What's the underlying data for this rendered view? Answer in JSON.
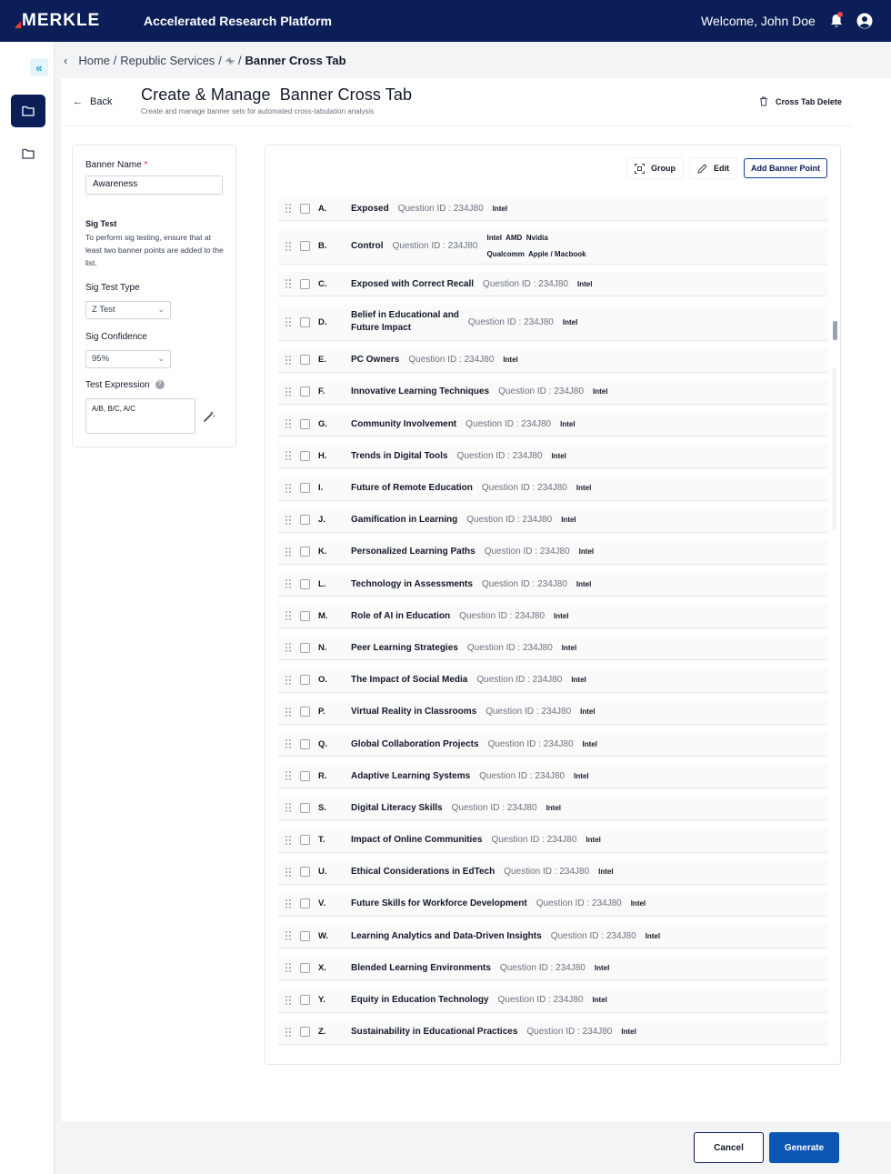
{
  "header": {
    "brand": "MERKLE",
    "app_title": "Accelerated Research Platform",
    "welcome": "Welcome, John Doe",
    "icons": [
      "notification-bell-icon",
      "user-profile-icon"
    ]
  },
  "breadcrumb": {
    "home": "Home /",
    "client": "Republic Services",
    "sep": "/ ",
    "current": "Banner Cross Tab"
  },
  "page": {
    "back": "Back",
    "title": "Create & Manage  Banner Cross Tab",
    "subtitle": "Create and manage banner sets for automated cross-tabulation analysis",
    "delete": "Cross Tab Delete"
  },
  "config": {
    "banner_name_label": "Banner Name",
    "required_mark": "*",
    "banner_name_value": "Awareness",
    "sig_test_title": "Sig Test",
    "sig_test_desc": "To perform sig testing, ensure that at least two banner points are added to the list.",
    "sig_test_type_label": "Sig Test Type",
    "sig_test_type_value": "Z Test",
    "sig_confidence_label": "Sig Confidence",
    "sig_confidence_value": "95%",
    "test_expression_label": "Test Expression",
    "help": "?",
    "test_expression_value": "A/B, B/C, A/C"
  },
  "toolbar": {
    "group": "Group",
    "edit": "Edit",
    "add": "Add Banner Point"
  },
  "rows": [
    {
      "letter": "A.",
      "title": "Exposed",
      "qid": "Question ID : 234J80",
      "tags": "Intel"
    },
    {
      "letter": "B.",
      "title": "Control",
      "qid": "Question ID : 234J80",
      "tags_line1": "Intel  AMD  Nvidia",
      "tags_line2": "Qualcomm  Apple / Macbook"
    },
    {
      "letter": "C.",
      "title": "Exposed with Correct Recall",
      "qid": "Question ID : 234J80",
      "tags": "Intel"
    },
    {
      "letter": "D.",
      "title_line1": "Belief in Educational and",
      "title_line2": "Future Impact",
      "qid": "Question ID : 234J80",
      "tags": "Intel"
    },
    {
      "letter": "E.",
      "title": "PC Owners",
      "qid": "Question ID : 234J80",
      "tags": "Intel"
    },
    {
      "letter": "F.",
      "title": "Innovative Learning Techniques",
      "qid": "Question ID : 234J80",
      "tags": "Intel"
    },
    {
      "letter": "G.",
      "title": "Community Involvement",
      "qid": "Question ID : 234J80",
      "tags": "Intel"
    },
    {
      "letter": "H.",
      "title": "Trends in Digital Tools",
      "qid": "Question ID : 234J80",
      "tags": "Intel"
    },
    {
      "letter": "I.",
      "title": "Future of Remote Education",
      "qid": "Question ID : 234J80",
      "tags": "Intel"
    },
    {
      "letter": "J.",
      "title": "Gamification in Learning",
      "qid": "Question ID : 234J80",
      "tags": "Intel"
    },
    {
      "letter": "K.",
      "title": "Personalized Learning Paths",
      "qid": "Question ID : 234J80",
      "tags": "Intel"
    },
    {
      "letter": "L.",
      "title": "Technology in Assessments",
      "qid": "Question ID : 234J80",
      "tags": "Intel"
    },
    {
      "letter": "M.",
      "title": "Role of AI in Education",
      "qid": "Question ID : 234J80",
      "tags": "Intel"
    },
    {
      "letter": "N.",
      "title": "Peer Learning Strategies",
      "qid": "Question ID : 234J80",
      "tags": "Intel"
    },
    {
      "letter": "O.",
      "title": "The Impact of Social Media",
      "qid": "Question ID : 234J80",
      "tags": "Intel"
    },
    {
      "letter": "P.",
      "title": "Virtual Reality in Classrooms",
      "qid": "Question ID : 234J80",
      "tags": "Intel"
    },
    {
      "letter": "Q.",
      "title": "Global Collaboration Projects",
      "qid": "Question ID : 234J80",
      "tags": "Intel"
    },
    {
      "letter": "R.",
      "title": "Adaptive Learning Systems",
      "qid": "Question ID : 234J80",
      "tags": "Intel"
    },
    {
      "letter": "S.",
      "title": "Digital Literacy Skills",
      "qid": "Question ID : 234J80",
      "tags": "Intel"
    },
    {
      "letter": "T.",
      "title": "Impact of Online Communities",
      "qid": "Question ID : 234J80",
      "tags": "Intel"
    },
    {
      "letter": "U.",
      "title": "Ethical Considerations in EdTech",
      "qid": "Question ID : 234J80",
      "tags": "Intel"
    },
    {
      "letter": "V.",
      "title": "Future Skills for Workforce Development",
      "qid": "Question ID : 234J80",
      "tags": "Intel"
    },
    {
      "letter": "W.",
      "title": "Learning Analytics and Data-Driven Insights",
      "qid": "Question ID : 234J80",
      "tags": "Intel"
    },
    {
      "letter": "X.",
      "title": "Blended Learning Environments",
      "qid": "Question ID : 234J80",
      "tags": "Intel"
    },
    {
      "letter": "Y.",
      "title": "Equity in Education Technology",
      "qid": "Question ID : 234J80",
      "tags": "Intel"
    },
    {
      "letter": "Z.",
      "title": "Sustainability in Educational Practices",
      "qid": "Question ID : 234J80",
      "tags": "Intel"
    }
  ],
  "footer": {
    "cancel": "Cancel",
    "generate": "Generate"
  },
  "colors": {
    "navy": "#0b1e57",
    "primary": "#0b56b3",
    "accent": "#1aa7d9",
    "brand_red": "#e6442f"
  }
}
